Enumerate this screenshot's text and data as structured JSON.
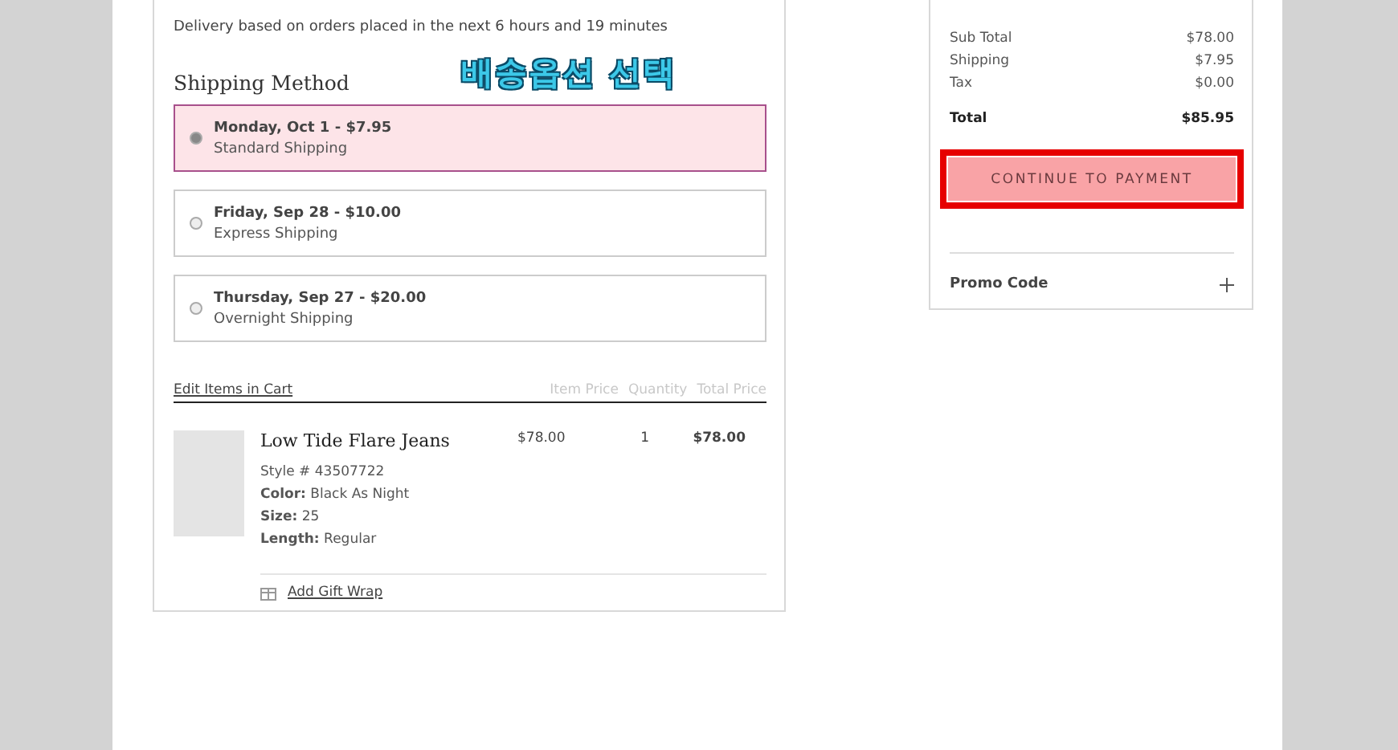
{
  "delivery_note": "Delivery based on orders placed in the next 6 hours and 19 minutes",
  "shipping_method": {
    "title": "Shipping Method",
    "annotation": "배송옵션 선택",
    "options": [
      {
        "date_price": "Monday, Oct 1 - $7.95",
        "service": "Standard Shipping",
        "selected": true
      },
      {
        "date_price": "Friday, Sep 28 - $10.00",
        "service": "Express Shipping",
        "selected": false
      },
      {
        "date_price": "Thursday, Sep 27 - $20.00",
        "service": "Overnight Shipping",
        "selected": false
      }
    ]
  },
  "cart": {
    "edit_link": "Edit Items in Cart",
    "columns": [
      "Item Price",
      "Quantity",
      "Total Price"
    ],
    "items": [
      {
        "name": "Low Tide Flare Jeans",
        "style": "Style # 43507722",
        "attributes": [
          {
            "label": "Color:",
            "value": "Black As Night"
          },
          {
            "label": "Size:",
            "value": "25"
          },
          {
            "label": "Length:",
            "value": "Regular"
          }
        ],
        "item_price": "$78.00",
        "quantity": "1",
        "total_price": "$78.00"
      }
    ],
    "gift_wrap": "Add Gift Wrap"
  },
  "order_summary": {
    "rows": [
      {
        "label": "Sub Total",
        "value": "$78.00",
        "kind": "line"
      },
      {
        "label": "Shipping",
        "value": "$7.95",
        "kind": "line"
      },
      {
        "label": "Tax",
        "value": "$0.00",
        "kind": "line"
      },
      {
        "label": "Total",
        "value": "$85.95",
        "kind": "total"
      }
    ],
    "button": {
      "label": "CONTINUE TO PAYMENT",
      "highlighted": true
    },
    "promo": "Promo Code"
  }
}
